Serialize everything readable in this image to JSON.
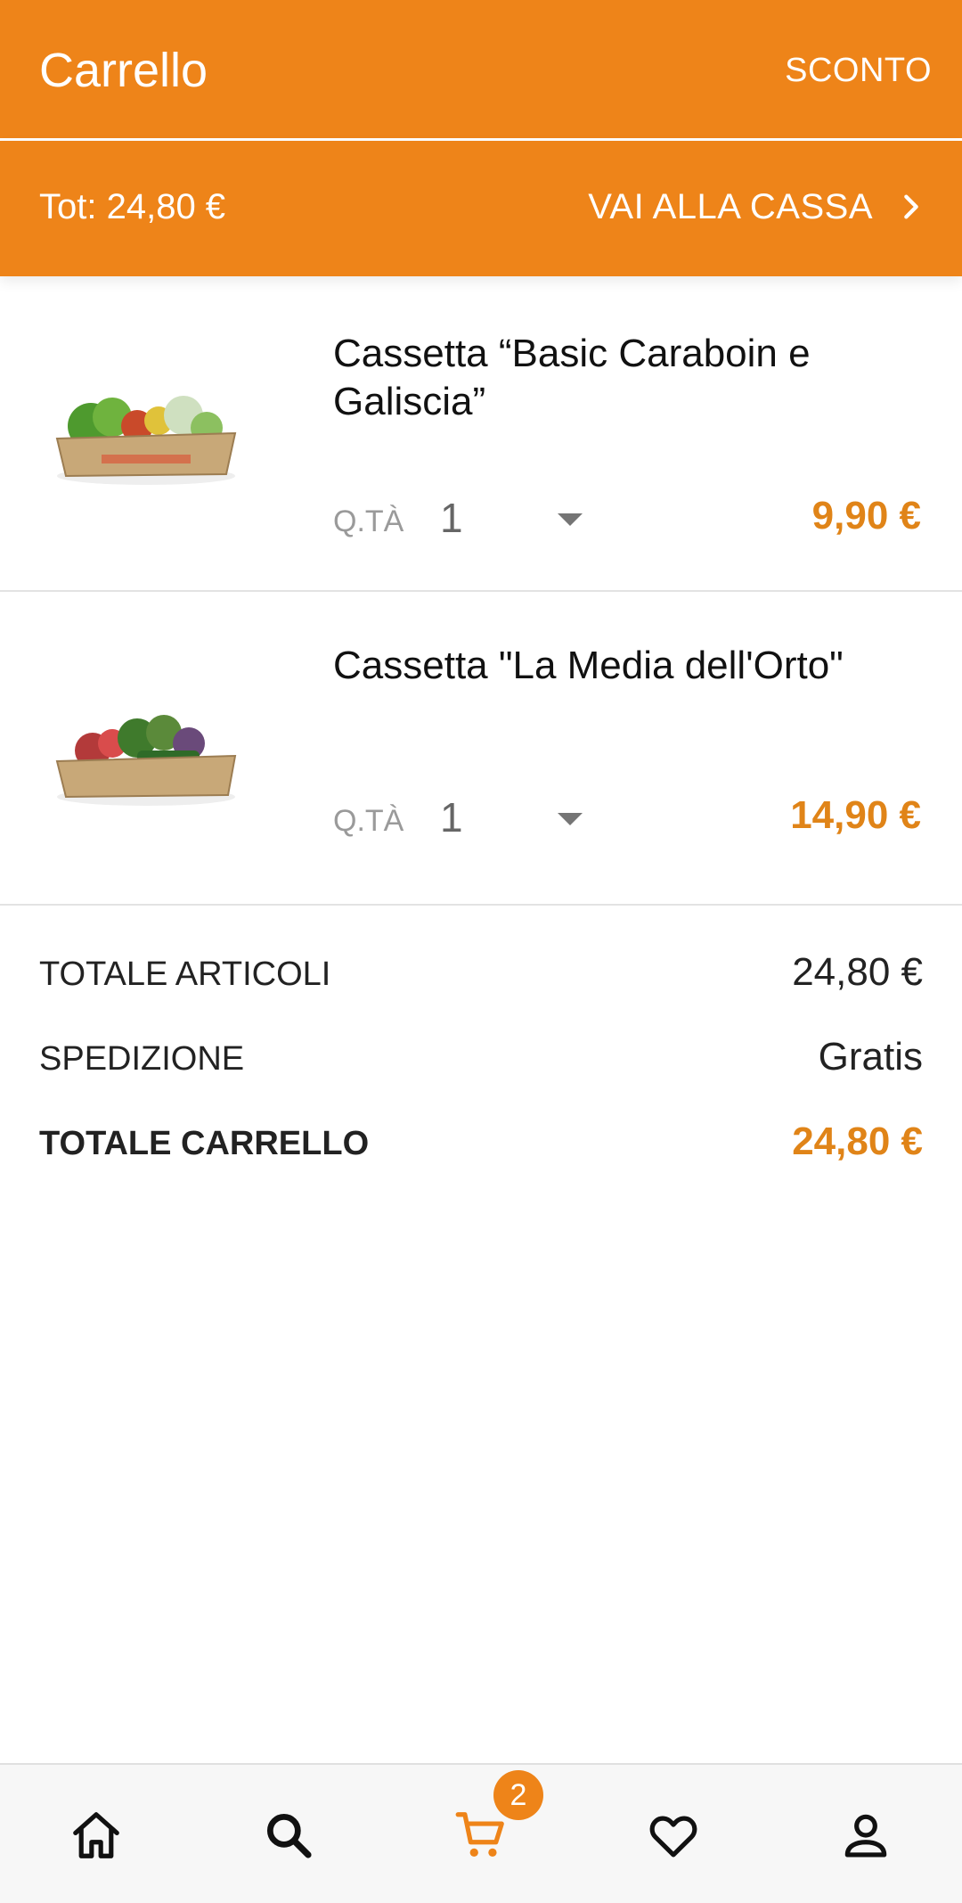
{
  "header": {
    "title": "Carrello",
    "discount_label": "SCONTO"
  },
  "summary_bar": {
    "total_text": "Tot: 24,80 €",
    "checkout_label": "VAI ALLA CASSA"
  },
  "items": [
    {
      "name": "Cassetta “Basic Caraboin e Galiscia”",
      "qty_label": "Q.TÀ",
      "qty": "1",
      "price": "9,90 €"
    },
    {
      "name": "Cassetta \"La Media dell'Orto\"",
      "qty_label": "Q.TÀ",
      "qty": "1",
      "price": "14,90 €"
    }
  ],
  "totals": [
    {
      "label": "TOTALE ARTICOLI",
      "value": "24,80 €"
    },
    {
      "label": "SPEDIZIONE",
      "value": "Gratis"
    },
    {
      "label": "TOTALE CARRELLO",
      "value": "24,80 €"
    }
  ],
  "nav": {
    "items": [
      "home-icon",
      "search-icon",
      "cart-icon",
      "heart-icon",
      "user-icon"
    ],
    "active": "cart-icon",
    "cart_badge": "2"
  },
  "colors": {
    "accent": "#ee8419",
    "price": "#e08418"
  }
}
